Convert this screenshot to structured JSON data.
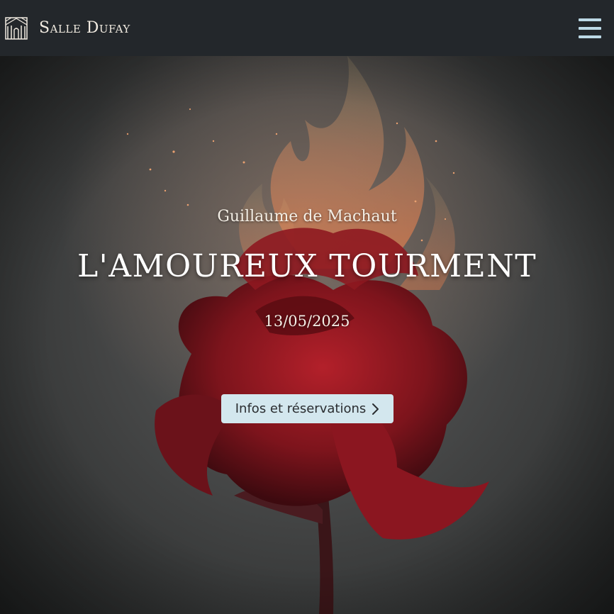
{
  "header": {
    "brand_name": "Salle Dufay",
    "logo_icon": "concert-hall-facade-icon",
    "menu_icon": "hamburger-menu-icon"
  },
  "hero": {
    "background_icon": "burning-red-rose-image",
    "composer": "Guillaume de Machaut",
    "title": "L'AMOUREUX TOURMENT",
    "date": "13/05/2025",
    "cta_label": "Infos et réservations",
    "cta_icon": "chevron-right-icon"
  },
  "colors": {
    "navbar_bg": "#23272b",
    "accent_light_blue": "#d3e7ee",
    "menu_icon": "#bcd9e6"
  }
}
